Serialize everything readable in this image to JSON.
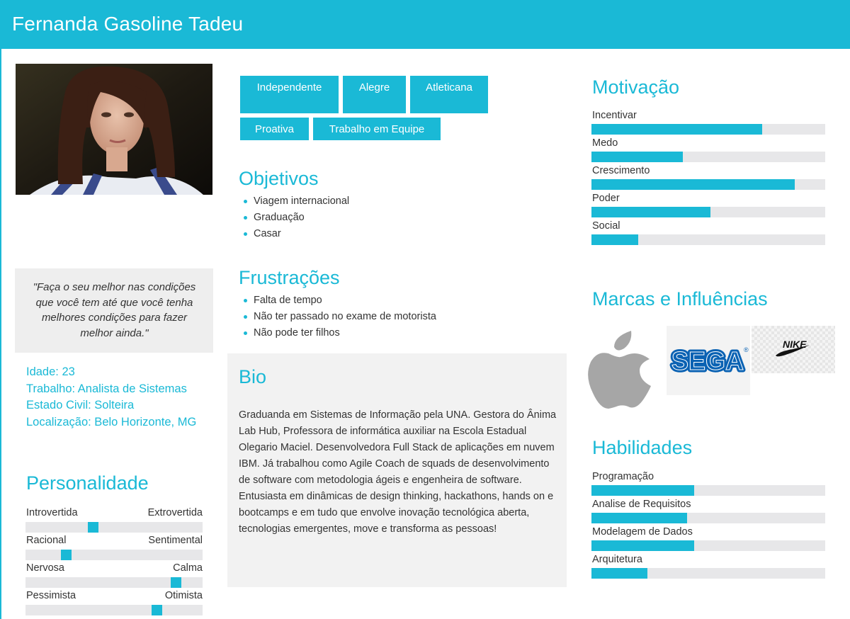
{
  "header": {
    "title": "Fernanda Gasoline Tadeu"
  },
  "quote": "\"Faça o seu melhor nas condições que você tem até que você tenha melhores condições para fazer melhor ainda.\"",
  "info": {
    "idade": "Idade: 23",
    "trabalho": "Trabalho: Analista de Sistemas",
    "estado_civil": "Estado Civil: Solteira",
    "localizacao": "Localização: Belo Horizonte, MG"
  },
  "personalidade": {
    "title": "Personalidade",
    "scales": [
      {
        "left": "Introvertida",
        "right": "Extrovertida",
        "value": 0.38
      },
      {
        "left": "Racional",
        "right": "Sentimental",
        "value": 0.23
      },
      {
        "left": "Nervosa",
        "right": "Calma",
        "value": 0.85
      },
      {
        "left": "Pessimista",
        "right": "Otimista",
        "value": 0.74
      }
    ]
  },
  "tags": [
    "Independente",
    "Alegre",
    "Atleticana",
    "Proativa",
    "Trabalho em Equipe"
  ],
  "objetivos": {
    "title": "Objetivos",
    "items": [
      "Viagem internacional",
      "Graduação",
      "Casar"
    ]
  },
  "frustracoes": {
    "title": "Frustrações",
    "items": [
      "Falta de tempo",
      "Não ter passado no exame de motorista",
      "Não pode ter filhos"
    ]
  },
  "bio": {
    "title": "Bio",
    "text": "Graduanda em Sistemas de Informação pela UNA. Gestora do Ânima Lab Hub, Professora de informática auxiliar na Escola Estadual Olegario Maciel. Desenvolvedora Full Stack de aplicações em nuvem IBM. Já trabalhou como Agile Coach de squads de desenvolvimento de software com metodologia ágeis e engenheira de software. Entusiasta em dinâmicas de design thinking, hackathons, hands on e bootcamps e em tudo que envolve inovação tecnológica aberta, tecnologias emergentes, move e transforma as pessoas!"
  },
  "motivacao": {
    "title": "Motivação",
    "items": [
      {
        "label": "Incentivar",
        "value": 0.73
      },
      {
        "label": "Medo",
        "value": 0.39
      },
      {
        "label": "Crescimento",
        "value": 0.87
      },
      {
        "label": "Poder",
        "value": 0.51
      },
      {
        "label": "Social",
        "value": 0.2
      }
    ]
  },
  "marcas": {
    "title": "Marcas e Influências",
    "brands": [
      {
        "icon": "apple-logo"
      },
      {
        "icon": "sega-logo",
        "text": "SEGA",
        "mark": "®"
      },
      {
        "icon": "nike-logo",
        "text": "NIKE"
      }
    ]
  },
  "habilidades": {
    "title": "Habilidades",
    "items": [
      {
        "label": "Programação",
        "value": 0.44
      },
      {
        "label": "Analise de Requisitos",
        "value": 0.41
      },
      {
        "label": "Modelagem de Dados",
        "value": 0.44
      },
      {
        "label": "Arquitetura",
        "value": 0.24
      }
    ]
  },
  "colors": {
    "accent": "#1ab9d6",
    "track": "#e7e7e9",
    "panel": "#eeeeee"
  }
}
